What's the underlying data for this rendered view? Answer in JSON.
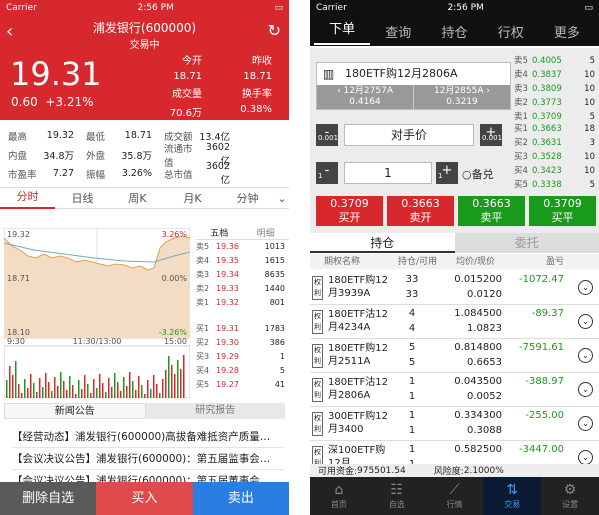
{
  "left": {
    "status": {
      "carrier": "Carrier",
      "time": "2:56 PM"
    },
    "header": {
      "title": "浦发银行(600000)",
      "subtitle": "交易中"
    },
    "quote": {
      "price": "19.31",
      "change": "0.60",
      "pct": "+3.21%",
      "open_label": "今开",
      "open": "18.71",
      "prev_label": "昨收",
      "prev": "18.71",
      "vol_label": "成交量",
      "vol": "70.6万",
      "turnover_label": "换手率",
      "turnover": "0.38%"
    },
    "stats": [
      [
        "最高",
        "19.32",
        "最低",
        "18.71",
        "成交额",
        "13.4亿"
      ],
      [
        "内盘",
        "34.8万",
        "外盘",
        "35.8万",
        "流通市值",
        "3602亿"
      ],
      [
        "市盈率",
        "7.27",
        "振幅",
        "3.26%",
        "总市值",
        "3602亿"
      ]
    ],
    "tabs": [
      "分时",
      "日线",
      "周K",
      "月K",
      "分钟"
    ],
    "chart": {
      "hi": "19.32",
      "lo": "18.10",
      "mid": "18.71",
      "pct_hi": "3.26%",
      "pct_mid": "0.00%",
      "pct_lo": "-3.26%",
      "t1": "9:30",
      "t2": "11:30/13:00",
      "t3": "15:00"
    },
    "book": {
      "tab1": "五档",
      "tab2": "明细",
      "asks": [
        [
          "卖5",
          "19.36",
          "1013"
        ],
        [
          "卖4",
          "19.35",
          "1615"
        ],
        [
          "卖3",
          "19.34",
          "8635"
        ],
        [
          "卖2",
          "19.33",
          "1440"
        ],
        [
          "卖1",
          "19.32",
          "801"
        ]
      ],
      "bids": [
        [
          "买1",
          "19.31",
          "1783"
        ],
        [
          "买2",
          "19.30",
          "386"
        ],
        [
          "买3",
          "19.29",
          "1"
        ],
        [
          "买4",
          "19.28",
          "5"
        ],
        [
          "买5",
          "19.27",
          "41"
        ]
      ]
    },
    "news_tabs": [
      "新闻公告",
      "研究报告"
    ],
    "news": [
      "【经营动态】浦发银行(600000)高拔备难抵资产质量…",
      "【会议决议公告】浦发银行(600000)：第五届监事会…",
      "【会议决议公告】浦发银行(600000)：第五届董事会…"
    ],
    "bottom": [
      "删除自选",
      "买入",
      "卖出"
    ]
  },
  "right": {
    "status": {
      "carrier": "Carrier",
      "time": "2:56 PM"
    },
    "tabs": [
      "下单",
      "查询",
      "持仓",
      "行权",
      "更多"
    ],
    "contract": {
      "name": "180ETF购12月2806A",
      "left_name": "12月2757A",
      "left_price": "0.4164",
      "right_name": "12月2855A",
      "right_price": "0.3219"
    },
    "price_mode": "对手价",
    "qty": "1",
    "step": "0.001",
    "stepq": "1",
    "covered": "备兑",
    "sells": [
      [
        "卖5",
        "0.4005",
        "5"
      ],
      [
        "卖4",
        "0.3837",
        "10"
      ],
      [
        "卖3",
        "0.3809",
        "10"
      ],
      [
        "卖2",
        "0.3773",
        "10"
      ],
      [
        "卖1",
        "0.3709",
        "5"
      ]
    ],
    "buys": [
      [
        "买1",
        "0.3663",
        "18"
      ],
      [
        "买2",
        "0.3631",
        "3"
      ],
      [
        "买3",
        "0.3528",
        "10"
      ],
      [
        "买4",
        "0.3423",
        "10"
      ],
      [
        "买5",
        "0.3338",
        "5"
      ]
    ],
    "trade": [
      [
        "0.3709",
        "买开"
      ],
      [
        "0.3663",
        "卖开"
      ],
      [
        "0.3663",
        "卖平"
      ],
      [
        "0.3709",
        "买平"
      ]
    ],
    "pos_tabs": [
      "持仓",
      "委托"
    ],
    "pos_head": [
      "期权名称",
      "持仓/可用",
      "均价/现价",
      "盈亏"
    ],
    "rows": [
      {
        "tag": "权利",
        "name": "180ETF购12月3939A",
        "q": "33",
        "a": "33",
        "p": "0.015200",
        "c": "0.0120",
        "pl": "-1072.47"
      },
      {
        "tag": "权利",
        "name": "180ETF沽12月4234A",
        "q": "4",
        "a": "4",
        "p": "1.084500",
        "c": "1.0823",
        "pl": "-89.37"
      },
      {
        "tag": "权利",
        "name": "180ETF购12月2511A",
        "q": "5",
        "a": "5",
        "p": "0.814800",
        "c": "0.6653",
        "pl": "-7591.61"
      },
      {
        "tag": "权利",
        "name": "180ETF沽12月2806A",
        "q": "1",
        "a": "1",
        "p": "0.043500",
        "c": "0.0052",
        "pl": "-388.97"
      },
      {
        "tag": "权利",
        "name": "300ETF购12月3400",
        "q": "1",
        "a": "1",
        "p": "0.334300",
        "c": "0.3088",
        "pl": "-255.00"
      },
      {
        "tag": "权利",
        "name": "深100ETF购12月...",
        "q": "1",
        "a": "1",
        "p": "0.582500",
        "c": "",
        "pl": "-3447.00"
      }
    ],
    "foot": {
      "funds_label": "可用资金:",
      "funds": "975501.54",
      "risk_label": "风险度:",
      "risk": "2.1000%"
    },
    "nav": [
      [
        "⌂",
        "首页"
      ],
      [
        "☷",
        "自选"
      ],
      [
        "⟋",
        "行情"
      ],
      [
        "⇅",
        "交易"
      ],
      [
        "⚙",
        "设置"
      ]
    ]
  }
}
